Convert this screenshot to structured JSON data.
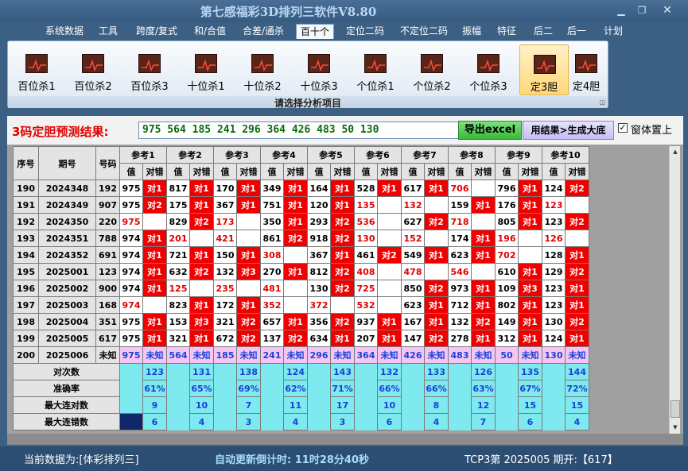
{
  "window": {
    "title": "第七感福彩3D排列三软件V8.80"
  },
  "menu": [
    "系统数据",
    "工具",
    "跨度/复式",
    "和/合值",
    "合差/通杀",
    "百十个",
    "定位二码",
    "不定位二码",
    "振幅",
    "特征",
    "后二",
    "后一",
    "计划"
  ],
  "menu_active": "百十个",
  "ribbon": {
    "buttons": [
      "百位杀1",
      "百位杀2",
      "百位杀3",
      "十位杀1",
      "十位杀2",
      "十位杀3",
      "个位杀1",
      "个位杀2",
      "个位杀3",
      "定3胆",
      "定4胆"
    ],
    "selected": "定3胆",
    "caption": "请选择分析项目"
  },
  "result": {
    "label": "3码定胆预测结果:",
    "value": "975 564 185 241 296 364 426 483 50 130",
    "excel_button": "导出excel",
    "big_button": "用结果>生成大底",
    "checkbox_label": "窗体置上",
    "checkbox_checked": true
  },
  "table": {
    "head_seq": "序号",
    "head_period": "期号",
    "head_code": "号码",
    "ref_headers": [
      "参考1",
      "参考2",
      "参考3",
      "参考4",
      "参考5",
      "参考6",
      "参考7",
      "参考8",
      "参考9",
      "参考10"
    ],
    "sub_value": "值",
    "sub_match": "对错",
    "rows": [
      {
        "seq": "190",
        "period": "2024348",
        "code": "192",
        "cells": [
          [
            "975",
            "w"
          ],
          [
            "对1",
            "r"
          ],
          [
            "817",
            "w"
          ],
          [
            "对1",
            "r"
          ],
          [
            "170",
            "w"
          ],
          [
            "对1",
            "r"
          ],
          [
            "349",
            "w"
          ],
          [
            "对1",
            "r"
          ],
          [
            "164",
            "w"
          ],
          [
            "对1",
            "r"
          ],
          [
            "528",
            "w"
          ],
          [
            "对1",
            "r"
          ],
          [
            "617",
            "w"
          ],
          [
            "对1",
            "r"
          ],
          [
            "706",
            "m"
          ],
          [
            "",
            "w"
          ],
          [
            "796",
            "w"
          ],
          [
            "对1",
            "r"
          ],
          [
            "124",
            "w"
          ],
          [
            "对2",
            "r"
          ]
        ]
      },
      {
        "seq": "191",
        "period": "2024349",
        "code": "907",
        "cells": [
          [
            "975",
            "w"
          ],
          [
            "对2",
            "r"
          ],
          [
            "175",
            "w"
          ],
          [
            "对1",
            "r"
          ],
          [
            "367",
            "w"
          ],
          [
            "对1",
            "r"
          ],
          [
            "751",
            "w"
          ],
          [
            "对1",
            "r"
          ],
          [
            "120",
            "w"
          ],
          [
            "对1",
            "r"
          ],
          [
            "135",
            "m"
          ],
          [
            "",
            "w"
          ],
          [
            "132",
            "m"
          ],
          [
            "",
            "w"
          ],
          [
            "159",
            "w"
          ],
          [
            "对1",
            "r"
          ],
          [
            "176",
            "w"
          ],
          [
            "对1",
            "r"
          ],
          [
            "123",
            "m"
          ],
          [
            "",
            "w"
          ]
        ]
      },
      {
        "seq": "192",
        "period": "2024350",
        "code": "220",
        "cells": [
          [
            "975",
            "m"
          ],
          [
            "",
            "w"
          ],
          [
            "829",
            "w"
          ],
          [
            "对2",
            "r"
          ],
          [
            "173",
            "m"
          ],
          [
            "",
            "w"
          ],
          [
            "350",
            "w"
          ],
          [
            "对1",
            "r"
          ],
          [
            "293",
            "w"
          ],
          [
            "对2",
            "r"
          ],
          [
            "536",
            "m"
          ],
          [
            "",
            "w"
          ],
          [
            "627",
            "w"
          ],
          [
            "对2",
            "r"
          ],
          [
            "718",
            "m"
          ],
          [
            "",
            "w"
          ],
          [
            "805",
            "w"
          ],
          [
            "对1",
            "r"
          ],
          [
            "123",
            "w"
          ],
          [
            "对2",
            "r"
          ]
        ]
      },
      {
        "seq": "193",
        "period": "2024351",
        "code": "788",
        "cells": [
          [
            "974",
            "w"
          ],
          [
            "对1",
            "r"
          ],
          [
            "201",
            "m"
          ],
          [
            "",
            "w"
          ],
          [
            "421",
            "m"
          ],
          [
            "",
            "w"
          ],
          [
            "861",
            "w"
          ],
          [
            "对2",
            "r"
          ],
          [
            "918",
            "w"
          ],
          [
            "对2",
            "r"
          ],
          [
            "130",
            "m"
          ],
          [
            "",
            "w"
          ],
          [
            "152",
            "m"
          ],
          [
            "",
            "w"
          ],
          [
            "174",
            "w"
          ],
          [
            "对1",
            "r"
          ],
          [
            "196",
            "m"
          ],
          [
            "",
            "w"
          ],
          [
            "126",
            "m"
          ],
          [
            "",
            "w"
          ]
        ]
      },
      {
        "seq": "194",
        "period": "2024352",
        "code": "691",
        "cells": [
          [
            "974",
            "w"
          ],
          [
            "对1",
            "r"
          ],
          [
            "721",
            "w"
          ],
          [
            "对1",
            "r"
          ],
          [
            "150",
            "w"
          ],
          [
            "对1",
            "r"
          ],
          [
            "308",
            "m"
          ],
          [
            "",
            "w"
          ],
          [
            "367",
            "w"
          ],
          [
            "对1",
            "r"
          ],
          [
            "461",
            "w"
          ],
          [
            "对2",
            "r"
          ],
          [
            "549",
            "w"
          ],
          [
            "对1",
            "r"
          ],
          [
            "623",
            "w"
          ],
          [
            "对1",
            "r"
          ],
          [
            "702",
            "m"
          ],
          [
            "",
            "w"
          ],
          [
            "128",
            "w"
          ],
          [
            "对1",
            "r"
          ]
        ]
      },
      {
        "seq": "195",
        "period": "2025001",
        "code": "123",
        "cells": [
          [
            "974",
            "w"
          ],
          [
            "对1",
            "r"
          ],
          [
            "632",
            "w"
          ],
          [
            "对2",
            "r"
          ],
          [
            "132",
            "w"
          ],
          [
            "对3",
            "r"
          ],
          [
            "270",
            "w"
          ],
          [
            "对1",
            "r"
          ],
          [
            "812",
            "w"
          ],
          [
            "对2",
            "r"
          ],
          [
            "408",
            "m"
          ],
          [
            "",
            "w"
          ],
          [
            "478",
            "m"
          ],
          [
            "",
            "w"
          ],
          [
            "546",
            "m"
          ],
          [
            "",
            "w"
          ],
          [
            "610",
            "w"
          ],
          [
            "对1",
            "r"
          ],
          [
            "129",
            "w"
          ],
          [
            "对2",
            "r"
          ]
        ]
      },
      {
        "seq": "196",
        "period": "2025002",
        "code": "900",
        "cells": [
          [
            "974",
            "w"
          ],
          [
            "对1",
            "r"
          ],
          [
            "125",
            "m"
          ],
          [
            "",
            "w"
          ],
          [
            "235",
            "m"
          ],
          [
            "",
            "w"
          ],
          [
            "481",
            "m"
          ],
          [
            "",
            "w"
          ],
          [
            "130",
            "w"
          ],
          [
            "对2",
            "r"
          ],
          [
            "725",
            "m"
          ],
          [
            "",
            "w"
          ],
          [
            "850",
            "w"
          ],
          [
            "对2",
            "r"
          ],
          [
            "973",
            "w"
          ],
          [
            "对1",
            "r"
          ],
          [
            "109",
            "w"
          ],
          [
            "对3",
            "r"
          ],
          [
            "123",
            "w"
          ],
          [
            "对1",
            "r"
          ]
        ]
      },
      {
        "seq": "197",
        "period": "2025003",
        "code": "168",
        "cells": [
          [
            "974",
            "m"
          ],
          [
            "",
            "w"
          ],
          [
            "823",
            "w"
          ],
          [
            "对1",
            "r"
          ],
          [
            "172",
            "w"
          ],
          [
            "对1",
            "r"
          ],
          [
            "352",
            "m"
          ],
          [
            "",
            "w"
          ],
          [
            "372",
            "m"
          ],
          [
            "",
            "w"
          ],
          [
            "532",
            "m"
          ],
          [
            "",
            "w"
          ],
          [
            "623",
            "w"
          ],
          [
            "对1",
            "r"
          ],
          [
            "712",
            "w"
          ],
          [
            "对1",
            "r"
          ],
          [
            "802",
            "w"
          ],
          [
            "对1",
            "r"
          ],
          [
            "123",
            "w"
          ],
          [
            "对1",
            "r"
          ]
        ]
      },
      {
        "seq": "198",
        "period": "2025004",
        "code": "351",
        "cells": [
          [
            "975",
            "w"
          ],
          [
            "对1",
            "r"
          ],
          [
            "153",
            "w"
          ],
          [
            "对3",
            "r"
          ],
          [
            "321",
            "w"
          ],
          [
            "对2",
            "r"
          ],
          [
            "657",
            "w"
          ],
          [
            "对1",
            "r"
          ],
          [
            "356",
            "w"
          ],
          [
            "对2",
            "r"
          ],
          [
            "937",
            "w"
          ],
          [
            "对1",
            "r"
          ],
          [
            "167",
            "w"
          ],
          [
            "对1",
            "r"
          ],
          [
            "132",
            "w"
          ],
          [
            "对2",
            "r"
          ],
          [
            "149",
            "w"
          ],
          [
            "对1",
            "r"
          ],
          [
            "130",
            "w"
          ],
          [
            "对2",
            "r"
          ]
        ]
      },
      {
        "seq": "199",
        "period": "2025005",
        "code": "617",
        "cells": [
          [
            "975",
            "w"
          ],
          [
            "对1",
            "r"
          ],
          [
            "321",
            "w"
          ],
          [
            "对1",
            "r"
          ],
          [
            "672",
            "w"
          ],
          [
            "对2",
            "r"
          ],
          [
            "137",
            "w"
          ],
          [
            "对2",
            "r"
          ],
          [
            "634",
            "w"
          ],
          [
            "对1",
            "r"
          ],
          [
            "207",
            "w"
          ],
          [
            "对1",
            "r"
          ],
          [
            "147",
            "w"
          ],
          [
            "对2",
            "r"
          ],
          [
            "278",
            "w"
          ],
          [
            "对1",
            "r"
          ],
          [
            "312",
            "w"
          ],
          [
            "对1",
            "r"
          ],
          [
            "124",
            "w"
          ],
          [
            "对1",
            "r"
          ]
        ]
      }
    ],
    "pending": {
      "seq": "200",
      "period": "2025006",
      "code": "未知",
      "values": [
        "975",
        "564",
        "185",
        "241",
        "296",
        "364",
        "426",
        "483",
        "50",
        "130"
      ],
      "unknown": "未知"
    },
    "stats": [
      {
        "label": "对次数",
        "values": [
          "123",
          "131",
          "138",
          "124",
          "143",
          "132",
          "133",
          "126",
          "135",
          "144"
        ]
      },
      {
        "label": "准确率",
        "values": [
          "61%",
          "65%",
          "69%",
          "62%",
          "71%",
          "66%",
          "66%",
          "63%",
          "67%",
          "72%"
        ]
      },
      {
        "label": "最大连对数",
        "values": [
          "9",
          "10",
          "7",
          "11",
          "17",
          "10",
          "8",
          "12",
          "15",
          "15"
        ]
      },
      {
        "label": "最大连错数",
        "values": [
          "6",
          "4",
          "3",
          "4",
          "3",
          "6",
          "4",
          "7",
          "6",
          "4"
        ]
      }
    ]
  },
  "status": {
    "source": "当前数据为:[体彩排列三]",
    "countdown": "自动更新倒计时: 11时28分40秒",
    "draw": "TCP3第 2025005 期开:【617】"
  }
}
